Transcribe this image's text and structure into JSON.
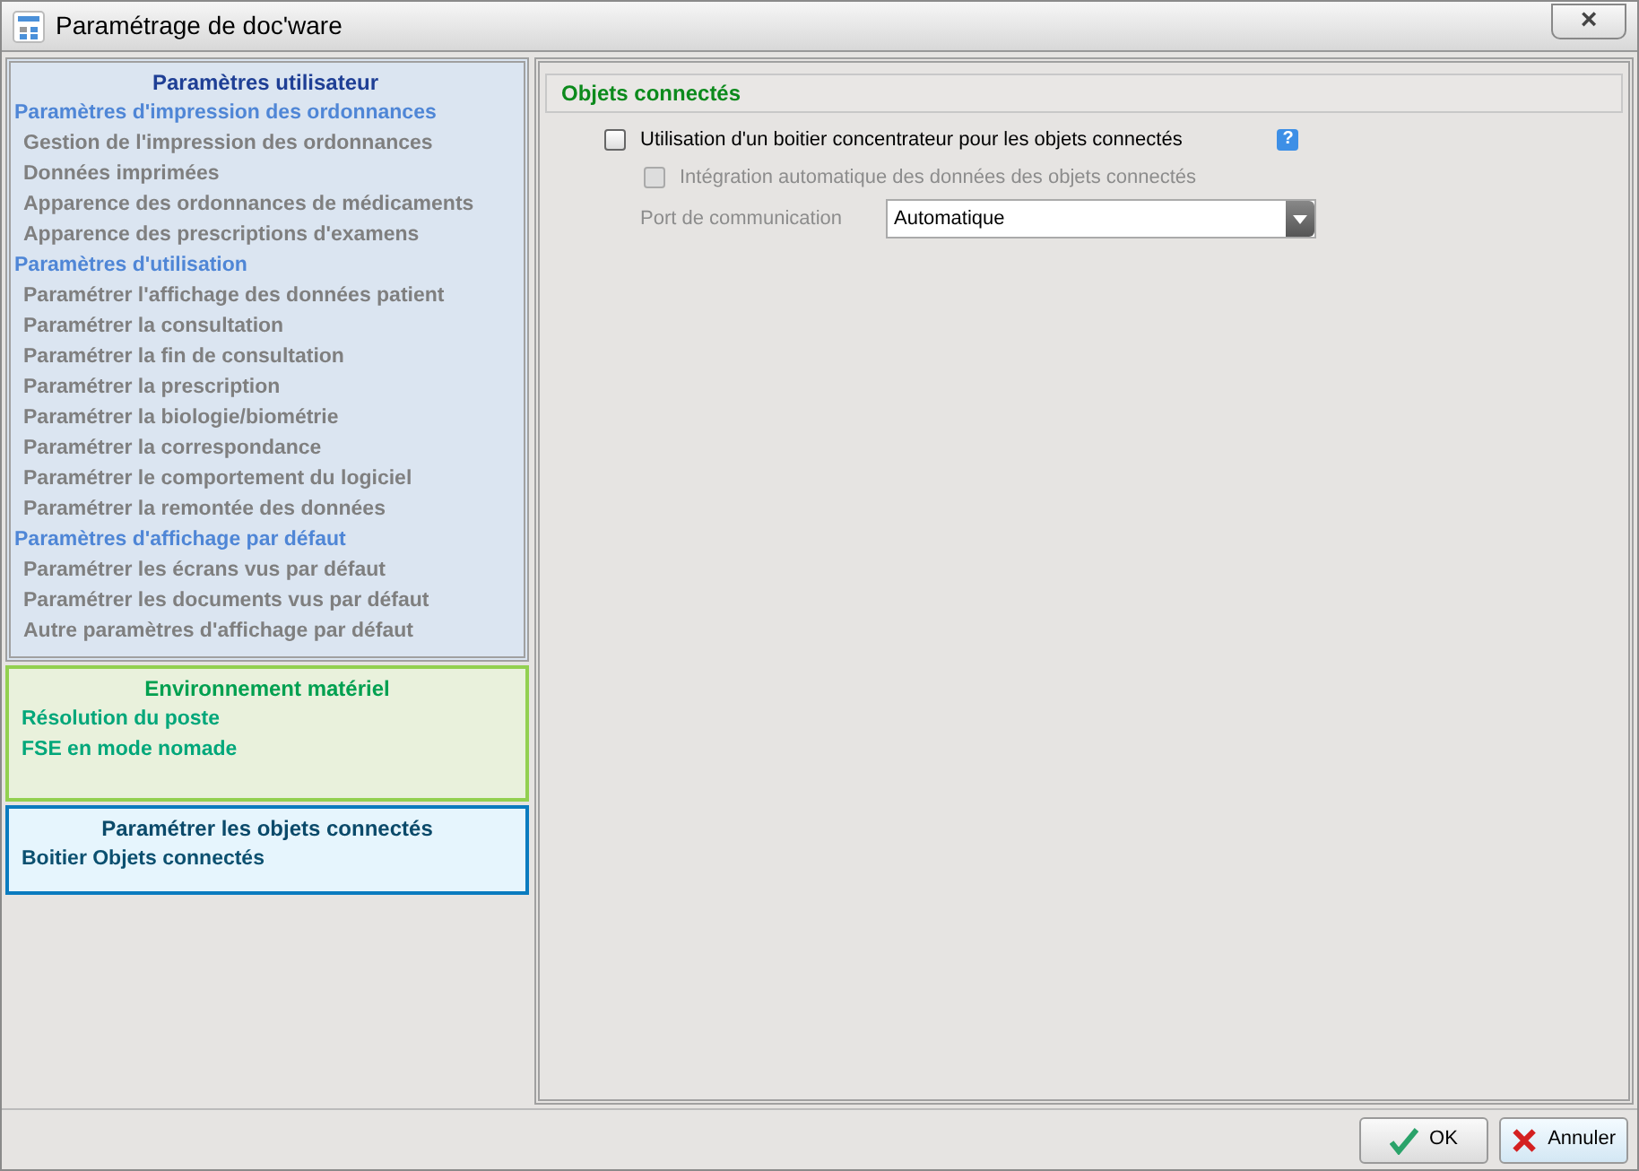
{
  "window": {
    "title": "Paramétrage de doc'ware",
    "close": "×"
  },
  "sections": [
    {
      "kind": "user",
      "title": "Paramètres utilisateur",
      "items": [
        {
          "kind": "group",
          "label": "Paramètres d'impression des ordonnances"
        },
        {
          "kind": "item",
          "label": "Gestion de l'impression des ordonnances"
        },
        {
          "kind": "item",
          "label": "Données imprimées"
        },
        {
          "kind": "item",
          "label": "Apparence des ordonnances de médicaments"
        },
        {
          "kind": "item",
          "label": "Apparence des prescriptions d'examens"
        },
        {
          "kind": "group",
          "label": "Paramètres d'utilisation"
        },
        {
          "kind": "item",
          "label": "Paramétrer l'affichage des données patient"
        },
        {
          "kind": "item",
          "label": "Paramétrer la consultation"
        },
        {
          "kind": "item",
          "label": "Paramétrer la fin de consultation"
        },
        {
          "kind": "item",
          "label": "Paramétrer la prescription"
        },
        {
          "kind": "item",
          "label": "Paramétrer la biologie/biométrie"
        },
        {
          "kind": "item",
          "label": "Paramétrer la correspondance"
        },
        {
          "kind": "item",
          "label": "Paramétrer le comportement du logiciel"
        },
        {
          "kind": "item",
          "label": "Paramétrer la remontée des données"
        },
        {
          "kind": "group",
          "label": "Paramètres d'affichage par défaut"
        },
        {
          "kind": "item",
          "label": "Paramétrer les écrans vus par défaut"
        },
        {
          "kind": "item",
          "label": "Paramétrer les documents vus par défaut"
        },
        {
          "kind": "item",
          "label": "Autre paramètres d'affichage par défaut"
        }
      ]
    },
    {
      "kind": "hardware",
      "title": "Environnement matériel",
      "items": [
        {
          "kind": "group",
          "label": "Résolution du poste"
        },
        {
          "kind": "group",
          "label": "FSE en mode nomade"
        }
      ]
    },
    {
      "kind": "devices",
      "title": "Paramétrer les objets connectés",
      "items": [
        {
          "kind": "group",
          "label": "Boitier Objets connectés"
        }
      ]
    }
  ],
  "panel": {
    "title": "Objets connectés",
    "main_option": {
      "label": "Utilisation d'un boitier concentrateur pour les objets connectés",
      "checked": false,
      "help": "?"
    },
    "sub_option": {
      "label": "Intégration automatique des données des objets connectés",
      "checked": false,
      "disabled": true
    },
    "port": {
      "label": "Port de communication",
      "value": "Automatique",
      "disabled": true
    }
  },
  "buttons": [
    {
      "kind": "ok",
      "label": "OK"
    },
    {
      "kind": "cancel",
      "label": "Annuler"
    }
  ]
}
